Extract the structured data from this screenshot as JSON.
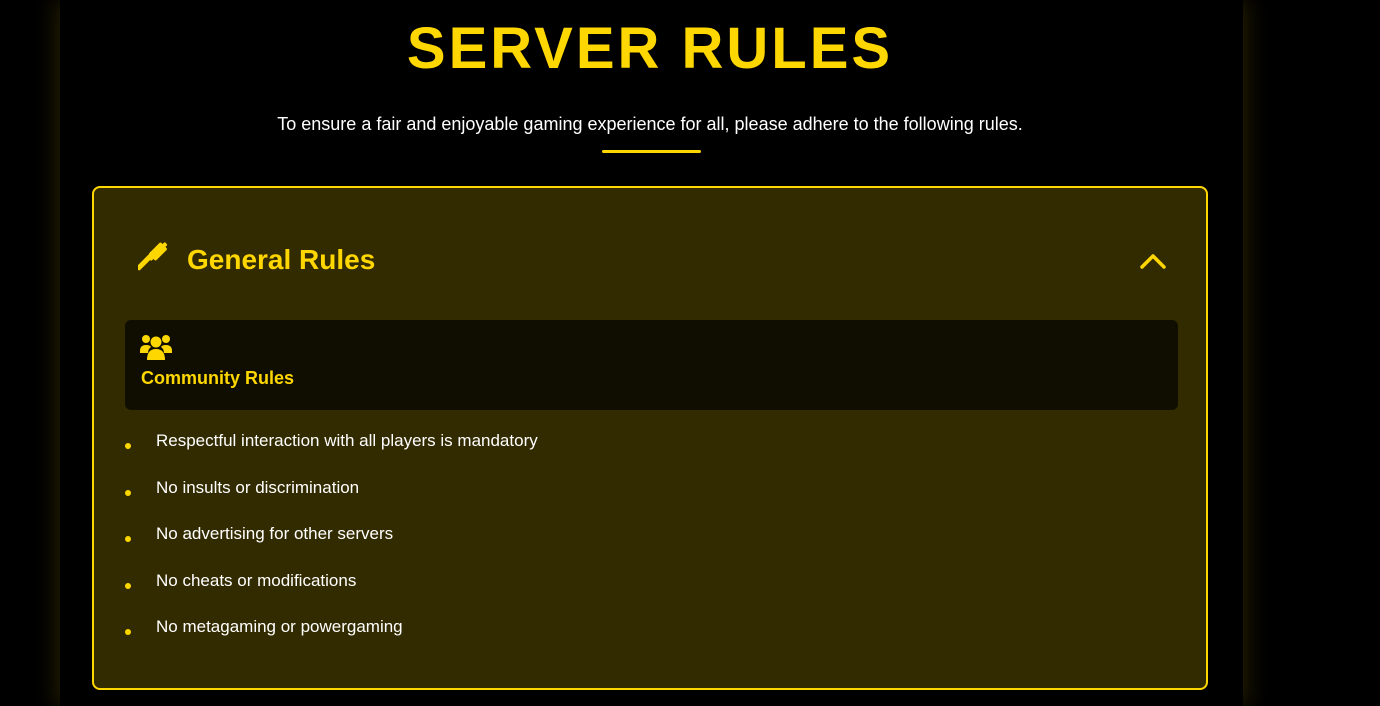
{
  "header": {
    "title": "SERVER RULES",
    "subtitle": "To ensure a fair and enjoyable gaming experience for all, please adhere to the following rules."
  },
  "colors": {
    "accent": "#ffd700",
    "background": "#000000",
    "panel": "#332b00",
    "card": "#0f0e00",
    "text": "#ffffff"
  },
  "section": {
    "title": "General Rules",
    "icon": "gavel-icon",
    "toggle_icon": "chevron-up-icon",
    "expanded": true,
    "category": {
      "icon": "users-icon",
      "title": "Community Rules"
    },
    "rules": [
      "Respectful interaction with all players is mandatory",
      "No insults or discrimination",
      "No advertising for other servers",
      "No cheats or modifications",
      "No metagaming or powergaming"
    ]
  }
}
